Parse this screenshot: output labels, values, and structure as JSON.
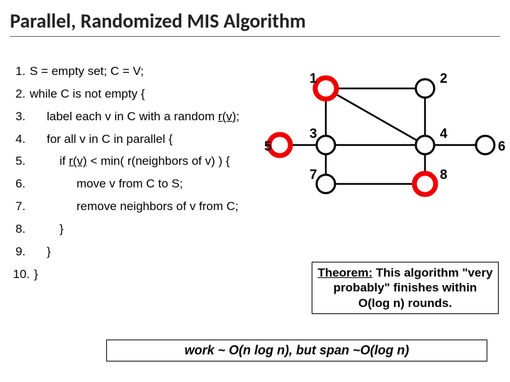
{
  "title": "Parallel, Randomized MIS Algorithm",
  "algo": {
    "l1": "S = empty set;  C = V;",
    "l2": "while  C  is not empty {",
    "l3": "label each v in C with a random ",
    "l3b": "r(v)",
    "l3c": ";",
    "l4": "for all v in C in parallel {",
    "l5a": "if ",
    "l5b": "r(v)",
    "l5c": " < min( r(neighbors of v) ) {",
    "l6": "move v from C to S;",
    "l7": "remove neighbors of v from C;",
    "l8": "}",
    "l9": "}",
    "l10": "}"
  },
  "graph": {
    "labels": {
      "n1": "1",
      "n2": "2",
      "n3": "3",
      "n4": "4",
      "n5": "5",
      "n6": "6",
      "n7": "7",
      "n8": "8"
    },
    "selected": [
      "n1",
      "n5",
      "n8"
    ]
  },
  "theorem": {
    "pre": "Theorem:",
    "body": "  This algorithm \"very probably\" finishes within O(log n) rounds."
  },
  "workline": "work ~ O(n log n),  but  span ~O(log n)"
}
